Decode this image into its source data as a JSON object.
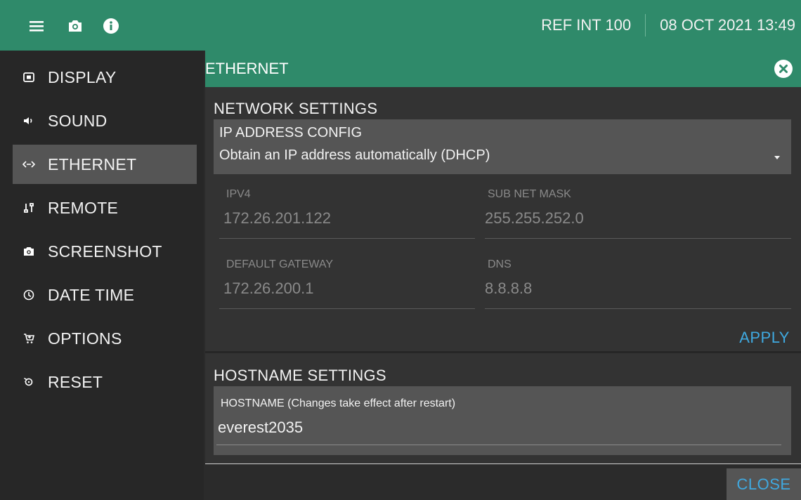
{
  "topbar": {
    "icons": [
      "menu-icon",
      "camera-icon",
      "info-icon"
    ],
    "reference": "REF INT 100",
    "datetime": "08 OCT 2021 13:49"
  },
  "sidebar": {
    "items": [
      {
        "label": "DISPLAY",
        "icon": "display-icon"
      },
      {
        "label": "SOUND",
        "icon": "speaker-icon"
      },
      {
        "label": "ETHERNET",
        "icon": "ethernet-icon",
        "active": true
      },
      {
        "label": "REMOTE",
        "icon": "remote-icon"
      },
      {
        "label": "SCREENSHOT",
        "icon": "camera-icon"
      },
      {
        "label": "DATE TIME",
        "icon": "clock-icon"
      },
      {
        "label": "OPTIONS",
        "icon": "cart-icon"
      },
      {
        "label": "RESET",
        "icon": "reset-icon"
      }
    ]
  },
  "panel": {
    "title": "ETHERNET",
    "network": {
      "title": "NETWORK SETTINGS",
      "ip_config": {
        "label": "IP ADDRESS CONFIG",
        "value": "Obtain an IP address automatically (DHCP)"
      },
      "fields": {
        "ipv4": {
          "label": "IPV4",
          "value": "172.26.201.122"
        },
        "subnet": {
          "label": "SUB NET MASK",
          "value": "255.255.252.0"
        },
        "gateway": {
          "label": "DEFAULT GATEWAY",
          "value": "172.26.200.1"
        },
        "dns": {
          "label": "DNS",
          "value": "8.8.8.8"
        }
      },
      "apply_label": "APPLY"
    },
    "hostname": {
      "title": "HOSTNAME SETTINGS",
      "label": "HOSTNAME (Changes take effect after restart)",
      "value": "everest2035"
    },
    "close_label": "CLOSE"
  },
  "colors": {
    "header_green": "#2f8a6a",
    "accent_blue": "#3fa9e0",
    "active_item": "#555555"
  }
}
